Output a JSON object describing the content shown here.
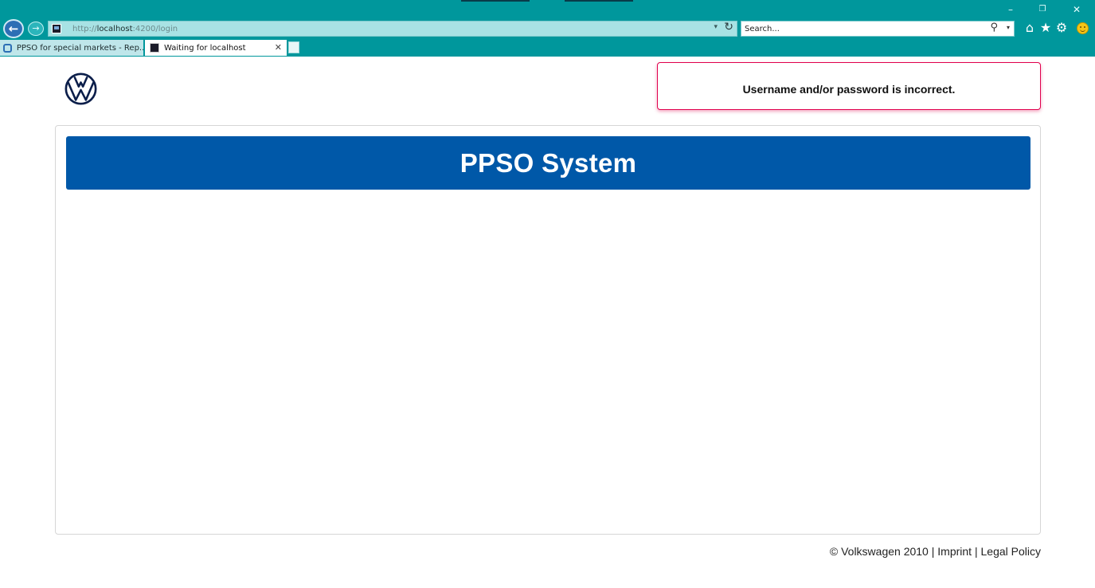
{
  "browser": {
    "address": {
      "scheme": "http://",
      "host": "localhost",
      "rest": ":4200/login"
    },
    "search_placeholder": "Search...",
    "tabs": [
      {
        "label": "PPSO for special markets - Rep..."
      },
      {
        "label": "Waiting for localhost"
      }
    ],
    "window_buttons": {
      "minimize": "–",
      "restore": "❐",
      "close": "✕"
    },
    "toolbar_icons": {
      "home": "⌂",
      "favorites": "★",
      "settings": "⚙"
    }
  },
  "notification": {
    "message": "Username and/or password is incorrect."
  },
  "app": {
    "title": "PPSO System"
  },
  "footer": {
    "copyright": "© Volkswagen 2010",
    "separator": " | ",
    "imprint": "Imprint",
    "legal": "Legal Policy"
  }
}
